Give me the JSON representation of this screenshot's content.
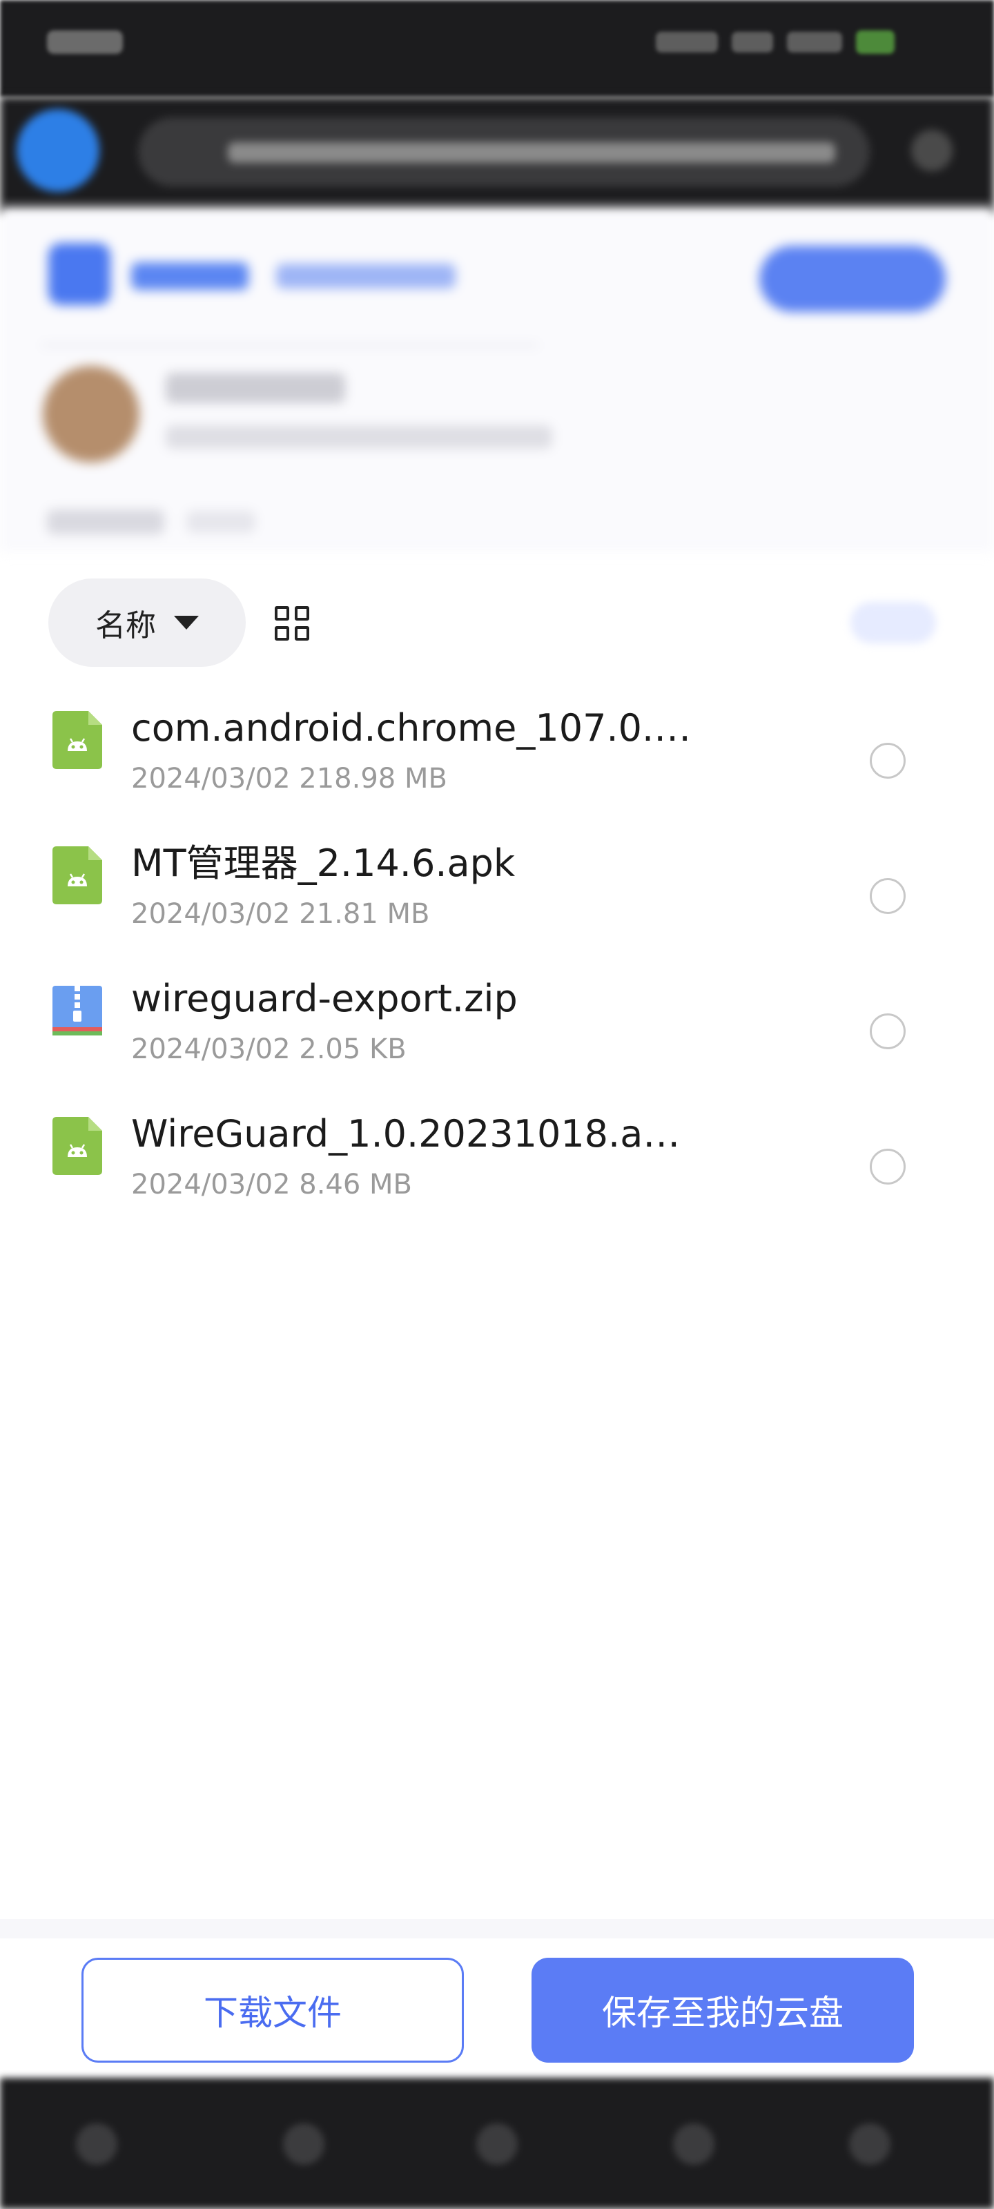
{
  "sort": {
    "label": "名称"
  },
  "icons": {
    "sort": "caret-down-icon",
    "view_toggle": "grid-view-icon",
    "apk": "android-apk-file-icon",
    "zip": "zip-archive-file-icon",
    "unselected": "radio-unchecked-icon"
  },
  "files": [
    {
      "name": "com.android.chrome_107.0.…",
      "meta": "2024/03/02 218.98 MB",
      "type": "apk"
    },
    {
      "name": "MT管理器_2.14.6.apk",
      "meta": "2024/03/02 21.81 MB",
      "type": "apk"
    },
    {
      "name": "wireguard-export.zip",
      "meta": "2024/03/02 2.05 KB",
      "type": "zip"
    },
    {
      "name": "WireGuard_1.0.20231018.a…",
      "meta": "2024/03/02 8.46 MB",
      "type": "apk"
    }
  ],
  "actions": {
    "download": "下载文件",
    "save": "保存至我的云盘"
  },
  "colors": {
    "accent": "#5b7cf5",
    "apk_icon": "#8bc34a",
    "zip_icon": "#6a9ef0"
  }
}
